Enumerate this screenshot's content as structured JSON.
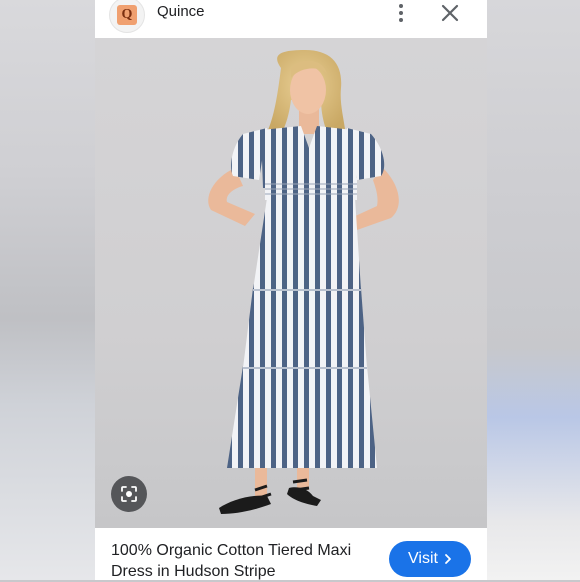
{
  "header": {
    "logo_letter": "Q",
    "site_name": "Quince"
  },
  "product": {
    "title": "100% Organic Cotton Tiered Maxi Dress in Hudson Stripe",
    "visit_label": "Visit"
  },
  "icons": {
    "more": "more-vert-icon",
    "close": "close-icon",
    "lens": "lens-icon",
    "visit_chevron": "chevron-right-icon"
  },
  "colors": {
    "accent": "#1a73e8",
    "logo": "#f0a070"
  }
}
